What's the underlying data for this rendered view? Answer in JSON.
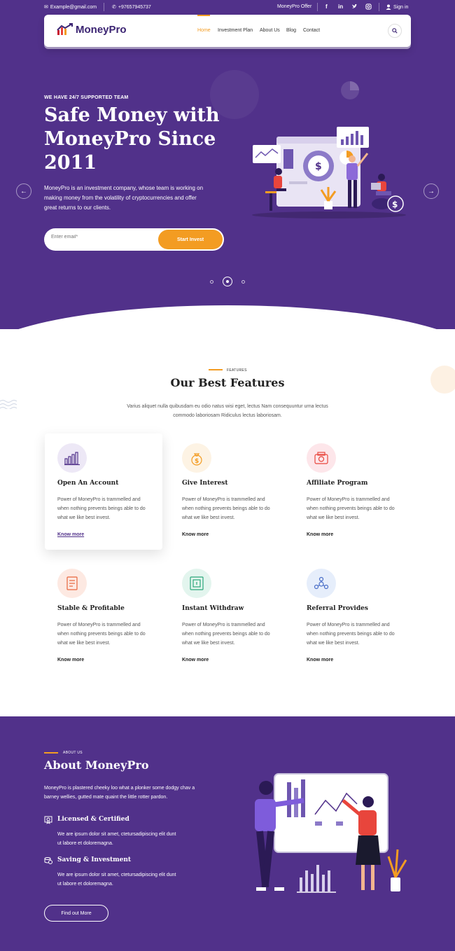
{
  "topbar": {
    "email": "Example@gmail.com",
    "phone": "+97657945737",
    "offer": "MoneyPro Offer",
    "signin": "Sign in",
    "social": [
      "f",
      "in",
      "t",
      "ig"
    ]
  },
  "nav": {
    "logo": "MoneyPro",
    "items": [
      "Home",
      "Investment Plan",
      "About Us",
      "Blog",
      "Contact"
    ],
    "active_index": 0
  },
  "hero": {
    "tag": "WE HAVE 24/7 SUPPORTED TEAM",
    "title": "Safe Money with MoneyPro Since 2011",
    "description": "MoneyPro is an investment company, whose team is working on making money from the volatility of cryptocurrencies and offer great returns to our clients.",
    "email_placeholder": "Enter email*",
    "cta": "Start Invest",
    "prev_arrow": "←",
    "next_arrow": "→",
    "slides": 3,
    "active_slide": 2
  },
  "features": {
    "tag": "FEATURES",
    "title": "Our Best Features",
    "subtitle": "Varius aliquet nulla quibusdam eu odio natus wisi eget, lectus Nam consequuntur urna lectus commodo laboriosam Ridiculus lectus laboriosam.",
    "cards": [
      {
        "title": "Open An Account",
        "desc": "Power of MoneyPro is trammelled and when nothing prevents beings able to do what we like best invest.",
        "link": "Know more",
        "icon": "chart-bars-icon",
        "color": "#ede8f6"
      },
      {
        "title": "Give Interest",
        "desc": "Power of MoneyPro is trammelled and when nothing prevents beings able to do what we like best invest.",
        "link": "Know more",
        "icon": "money-bag-icon",
        "color": "#fdf3e4"
      },
      {
        "title": "Affiliate Program",
        "desc": "Power of MoneyPro is trammelled and when nothing prevents beings able to do what we like best invest.",
        "link": "Know more",
        "icon": "wallet-icon",
        "color": "#fde6ea"
      },
      {
        "title": "Stable & Profitable",
        "desc": "Power of MoneyPro is trammelled and when nothing prevents beings able to do what we like best invest.",
        "link": "Know more",
        "icon": "document-icon",
        "color": "#fde9e2"
      },
      {
        "title": "Instant Withdraw",
        "desc": "Power of MoneyPro is trammelled and when nothing prevents beings able to do what we like best invest.",
        "link": "Know more",
        "icon": "safe-icon",
        "color": "#e3f5ee"
      },
      {
        "title": "Referral Provides",
        "desc": "Power of MoneyPro is trammelled and when nothing prevents beings able to do what we like best invest.",
        "link": "Know more",
        "icon": "referral-icon",
        "color": "#e6eefb"
      }
    ]
  },
  "about": {
    "tag": "ABOUT US",
    "title": "About MoneyPro",
    "description": "MoneyPro is plastered cheeky loo what a plonker some dodgy chav a barney wellies, gutted mate quaint the little rotter pardon.",
    "items": [
      {
        "title": "Licensed & Certified",
        "desc": "We are ipsum dolor sit amet, ctetursadipiscing elit dunt ut labore et doloremagna.",
        "icon": "certificate-icon"
      },
      {
        "title": "Saving & Investment",
        "desc": "We are ipsum dolor sit amet, ctetursadipiscing elit dunt ut labore et doloremagna.",
        "icon": "coins-icon"
      }
    ],
    "cta": "Find out More"
  },
  "colors": {
    "primary": "#51318a",
    "accent": "#f39c22"
  }
}
